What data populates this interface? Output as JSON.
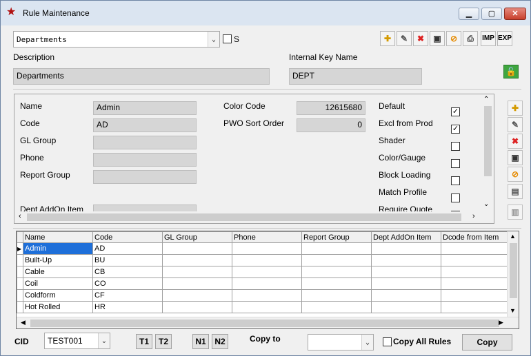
{
  "window": {
    "title": "Rule Maintenance",
    "min": "▁",
    "max": "▢",
    "close": "✕"
  },
  "top": {
    "dropdown_value": "Departments",
    "s_label": "S"
  },
  "toolbar": {
    "imp": "IMP",
    "exp": "EXP"
  },
  "fields": {
    "description_label": "Description",
    "description_value": "Departments",
    "internal_key_label": "Internal Key Name",
    "internal_key_value": "DEPT"
  },
  "detail": {
    "name_label": "Name",
    "name_value": "Admin",
    "code_label": "Code",
    "code_value": "AD",
    "gl_group_label": "GL Group",
    "phone_label": "Phone",
    "report_group_label": "Report Group",
    "dept_addon_label": "Dept AddOn Item",
    "color_code_label": "Color Code",
    "color_code_value": "12615680",
    "pwo_sort_label": "PWO Sort Order",
    "pwo_sort_value": "0",
    "checks": [
      {
        "label": "Default",
        "checked": true
      },
      {
        "label": "Excl from Prod",
        "checked": true
      },
      {
        "label": "Shader",
        "checked": false
      },
      {
        "label": "Color/Gauge",
        "checked": false
      },
      {
        "label": "Block Loading",
        "checked": false
      },
      {
        "label": "Match Profile",
        "checked": false
      },
      {
        "label": "Require Quote",
        "checked": false
      }
    ]
  },
  "grid": {
    "columns": [
      "Name",
      "Code",
      "GL Group",
      "Phone",
      "Report Group",
      "Dept AddOn Item",
      "Dcode from Item"
    ],
    "rows": [
      [
        "Admin",
        "AD",
        "",
        "",
        "",
        "",
        ""
      ],
      [
        "Built-Up",
        "BU",
        "",
        "",
        "",
        "",
        ""
      ],
      [
        "Cable",
        "CB",
        "",
        "",
        "",
        "",
        ""
      ],
      [
        "Coil",
        "CO",
        "",
        "",
        "",
        "",
        ""
      ],
      [
        "Coldform",
        "CF",
        "",
        "",
        "",
        "",
        ""
      ],
      [
        "Hot Rolled",
        "HR",
        "",
        "",
        "",
        "",
        ""
      ]
    ],
    "selected_index": 0,
    "selected_marker": "▶"
  },
  "footer": {
    "cid_label": "CID",
    "cid_value": "TEST001",
    "t1": "T1",
    "t2": "T2",
    "n1": "N1",
    "n2": "N2",
    "copy_to_label": "Copy to",
    "copy_to_value": "",
    "copy_all_label": "Copy All Rules",
    "copy_all_checked": false,
    "copy_button": "Copy"
  },
  "colors": {
    "selection": "#1e6fd9",
    "readonly": "#d6d6d6",
    "window_bg": "#f0f0f0",
    "title_bar": "#dbe5f1"
  },
  "icons": {
    "toolbar": [
      "new-record-icon",
      "edit-icon",
      "delete-icon",
      "save-icon",
      "cancel-icon",
      "print-icon"
    ],
    "unlock": "unlock-icon",
    "side": [
      "new-icon",
      "edit-icon",
      "delete-icon",
      "save-icon",
      "cancel-icon",
      "image-icon",
      "paste-icon"
    ]
  }
}
